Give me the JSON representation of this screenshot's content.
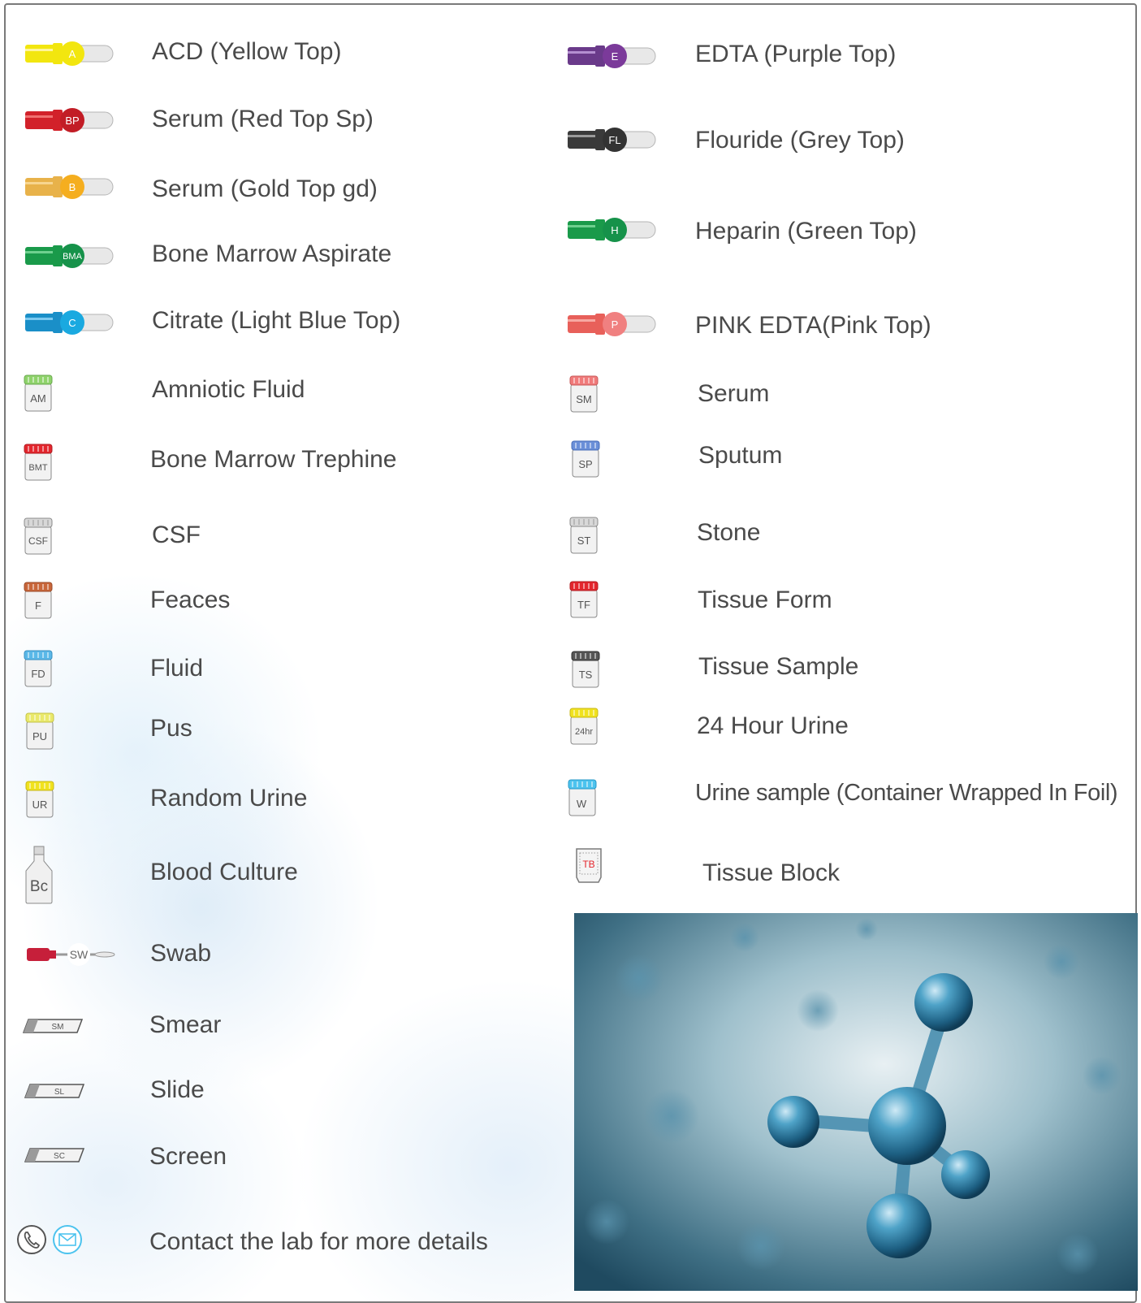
{
  "left_column": [
    {
      "label": "ACD (Yellow Top)",
      "code": "A",
      "icon": "tube-icon",
      "color": "#f2e60f"
    },
    {
      "label": "Serum (Red Top Sp)",
      "code": "BP",
      "icon": "tube-icon",
      "color": "#d2212a"
    },
    {
      "label": "Serum (Gold Top gd)",
      "code": "B",
      "icon": "tube-icon",
      "color": "#f5ae1f"
    },
    {
      "label": "Bone Marrow Aspirate",
      "code": "BMA",
      "icon": "tube-icon",
      "color": "#1a9a4a"
    },
    {
      "label": "Citrate (Light Blue Top)",
      "code": "C",
      "icon": "tube-icon",
      "color": "#1aa9e0"
    },
    {
      "label": "Amniotic Fluid",
      "code": "AM",
      "icon": "pot-icon",
      "color": "#8fd36b"
    },
    {
      "label": "Bone Marrow Trephine",
      "code": "BMT",
      "icon": "pot-icon",
      "color": "#e3262d"
    },
    {
      "label": "CSF",
      "code": "CSF",
      "icon": "pot-icon",
      "color": "#d8d8d8"
    },
    {
      "label": "Feaces",
      "code": "F",
      "icon": "pot-icon",
      "color": "#c8663a"
    },
    {
      "label": "Fluid",
      "code": "FD",
      "icon": "pot-icon",
      "color": "#5ab8e8"
    },
    {
      "label": "Pus",
      "code": "PU",
      "icon": "pot-icon",
      "color": "#eae96b"
    },
    {
      "label": "Random Urine",
      "code": "UR",
      "icon": "pot-icon",
      "color": "#f0e21e"
    },
    {
      "label": "Blood Culture",
      "code": "Bc",
      "icon": "bottle-icon",
      "color": "#e0e0e0"
    },
    {
      "label": "Swab",
      "code": "SW",
      "icon": "swab-icon",
      "color": "#c61f3a"
    },
    {
      "label": "Smear",
      "code": "SM",
      "icon": "slide-icon",
      "color": "#8a8a8a"
    },
    {
      "label": "Slide",
      "code": "SL",
      "icon": "slide-icon",
      "color": "#8a8a8a"
    },
    {
      "label": "Screen",
      "code": "SC",
      "icon": "slide-icon",
      "color": "#8a8a8a"
    }
  ],
  "right_column": [
    {
      "label": "EDTA (Purple Top)",
      "code": "E",
      "icon": "tube-icon",
      "color": "#7b3a9a"
    },
    {
      "label": "Flouride (Grey Top)",
      "code": "FL",
      "icon": "tube-icon",
      "color": "#3a3a3a"
    },
    {
      "label": "Heparin (Green Top)",
      "code": "H",
      "icon": "tube-icon",
      "color": "#1a9a4a"
    },
    {
      "label": "PINK EDTA(Pink Top)",
      "code": "P",
      "icon": "tube-icon",
      "color": "#f08080"
    },
    {
      "label": "Serum",
      "code": "SM",
      "icon": "pot-icon",
      "color": "#f07a7a"
    },
    {
      "label": "Sputum",
      "code": "SP",
      "icon": "pot-icon",
      "color": "#6a8fd8"
    },
    {
      "label": "Stone",
      "code": "ST",
      "icon": "pot-icon",
      "color": "#d8d8d8"
    },
    {
      "label": "Tissue Form",
      "code": "TF",
      "icon": "pot-icon",
      "color": "#e3262d"
    },
    {
      "label": "Tissue Sample",
      "code": "TS",
      "icon": "pot-icon",
      "color": "#555555"
    },
    {
      "label": "24 Hour Urine",
      "code": "24hr",
      "icon": "pot-icon",
      "color": "#f0e21e"
    },
    {
      "label": "Urine sample (Container Wrapped In Foil)",
      "code": "W",
      "icon": "pot-icon",
      "color": "#4cc3ee"
    },
    {
      "label": "Tissue Block",
      "code": "TB",
      "icon": "block-icon",
      "color": "#e3262d"
    }
  ],
  "footer": {
    "contact": "Contact the lab for more details",
    "phone_icon": "phone-icon",
    "email_icon": "email-icon"
  },
  "photo": {
    "subject": "molecule-image"
  }
}
